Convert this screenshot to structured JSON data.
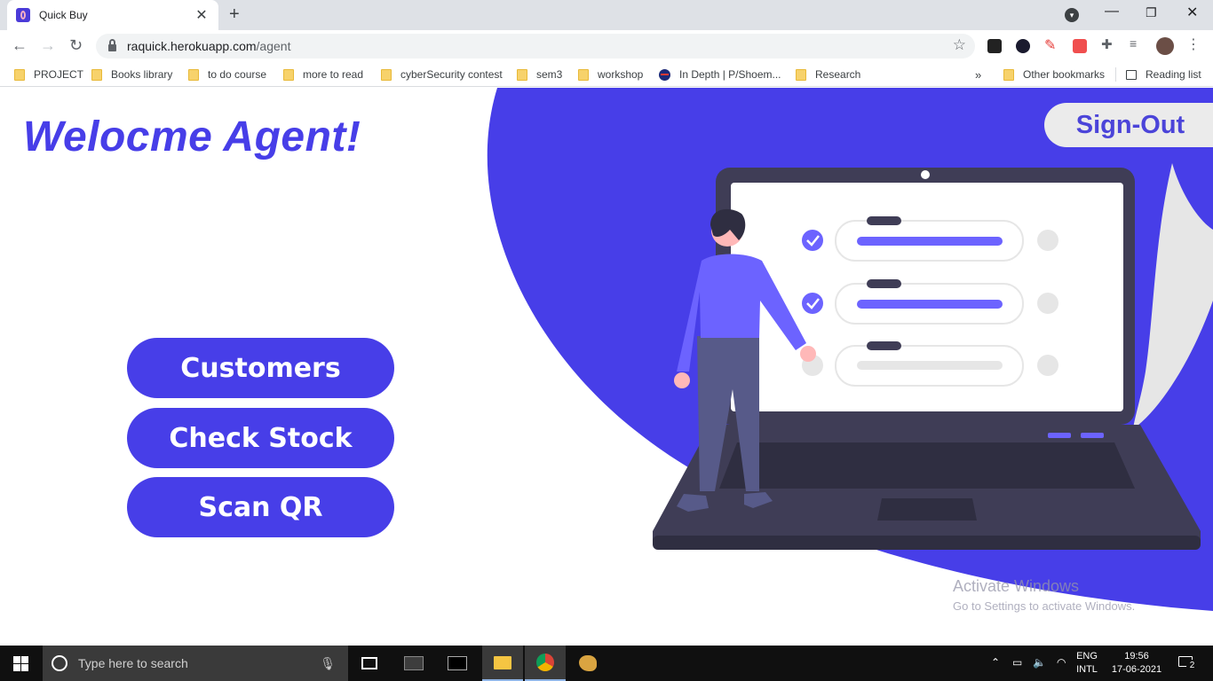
{
  "browser": {
    "tab_title": "Quick Buy",
    "url_host": "raquick.herokuapp.com",
    "url_path": "/agent",
    "bookmarks": [
      "PROJECT",
      "Books library",
      "to do course",
      "more to read",
      "cyberSecurity contest",
      "sem3",
      "workshop",
      "In Depth | P/Shoem...",
      "Research"
    ],
    "other_bookmarks": "Other bookmarks",
    "reading_list": "Reading list",
    "overflow": "»"
  },
  "page": {
    "heading": "Welocme Agent!",
    "signout_label": "Sign-Out",
    "buttons": [
      "Customers",
      "Check Stock",
      "Scan QR"
    ],
    "colors": {
      "primary": "#473ee8",
      "signout_bg": "#ebebeb",
      "laptop": "#3f3d56"
    }
  },
  "watermark": {
    "line1": "Activate Windows",
    "line2": "Go to Settings to activate Windows."
  },
  "taskbar": {
    "search_placeholder": "Type here to search",
    "lang": "ENG",
    "layout": "INTL",
    "time": "19:56",
    "date": "17-06-2021",
    "notifications": "2"
  }
}
